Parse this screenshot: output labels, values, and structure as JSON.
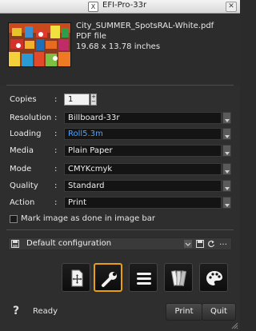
{
  "window": {
    "title": "EFI-Pro-33r",
    "close_symbol": "✕"
  },
  "file": {
    "name": "City_SUMMER_SpotsRAL-White.pdf",
    "type": "PDF file",
    "size": "19.68 x 13.78 inches"
  },
  "settings": {
    "copies": {
      "label": "Copies",
      "value": "1"
    },
    "resolution": {
      "label": "Resolution",
      "value": "Billboard-33r"
    },
    "loading": {
      "label": "Loading",
      "value": "Roll5.3m"
    },
    "media": {
      "label": "Media",
      "value": "Plain Paper"
    },
    "mode": {
      "label": "Mode",
      "value": "CMYKcmyk"
    },
    "quality": {
      "label": "Quality",
      "value": "Standard"
    },
    "action": {
      "label": "Action",
      "value": "Print"
    }
  },
  "mark_done": {
    "label": "Mark image as done in image bar",
    "checked": false
  },
  "configuration": {
    "value": "Default configuration"
  },
  "toolbar": {
    "buttons": [
      {
        "name": "layout",
        "icon": "page-move-icon"
      },
      {
        "name": "settings",
        "icon": "wrench-icon",
        "active": true
      },
      {
        "name": "list",
        "icon": "menu-lines-icon"
      },
      {
        "name": "swatches",
        "icon": "color-swatches-icon"
      },
      {
        "name": "palette",
        "icon": "palette-icon"
      }
    ]
  },
  "status": {
    "help": "?",
    "text": "Ready"
  },
  "buttons": {
    "print": "Print",
    "quit": "Quit"
  },
  "colors": {
    "accent": "#e8a012",
    "link": "#4da3ff"
  }
}
